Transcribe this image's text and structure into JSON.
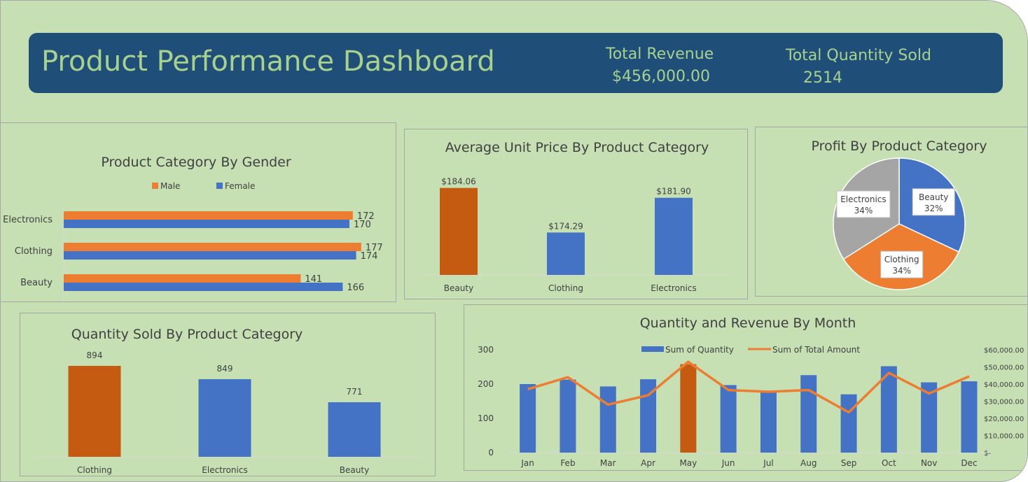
{
  "header": {
    "title": "Product Performance Dashboard",
    "kpis": [
      {
        "label": "Total Revenue",
        "value": "$456,000.00"
      },
      {
        "label": "Total Quantity Sold",
        "value": "2514"
      }
    ]
  },
  "colors": {
    "background": "#c6e0b4",
    "banner": "#1f4e79",
    "banner_text": "#a9d18e",
    "orange": "#ed7d31",
    "dark_orange": "#c55a11",
    "blue": "#4472c4",
    "gray": "#a5a5a5"
  },
  "chart_data": [
    {
      "id": "gender",
      "type": "bar",
      "orientation": "horizontal",
      "title": "Product Category By Gender",
      "categories": [
        "Electronics",
        "Clothing",
        "Beauty"
      ],
      "series": [
        {
          "name": "Male",
          "values": [
            172,
            177,
            141
          ],
          "color": "#ed7d31"
        },
        {
          "name": "Female",
          "values": [
            170,
            174,
            166
          ],
          "color": "#4472c4"
        }
      ],
      "xlim": [
        0,
        200
      ],
      "legend": "top",
      "grid": false
    },
    {
      "id": "price",
      "type": "bar",
      "title": "Average Unit  Price By Product Category",
      "categories": [
        "Beauty",
        "Clothing",
        "Electronics"
      ],
      "values": [
        184.06,
        174.29,
        181.9
      ],
      "value_labels": [
        "$184.06",
        "$174.29",
        "$181.90"
      ],
      "colors": [
        "#c55a11",
        "#4472c4",
        "#4472c4"
      ],
      "ylim": [
        165,
        186
      ],
      "grid": false
    },
    {
      "id": "profit",
      "type": "pie",
      "title": "Profit By Product Category",
      "labels": [
        "Beauty",
        "Clothing",
        "Electronics"
      ],
      "values": [
        32,
        34,
        34
      ],
      "value_labels": [
        "32%",
        "34%",
        "34%"
      ],
      "colors": [
        "#4472c4",
        "#ed7d31",
        "#a5a5a5"
      ]
    },
    {
      "id": "qty",
      "type": "bar",
      "title": "Quantity Sold By Product Category",
      "categories": [
        "Clothing",
        "Electronics",
        "Beauty"
      ],
      "values": [
        894,
        849,
        771
      ],
      "colors": [
        "#c55a11",
        "#4472c4",
        "#4472c4"
      ],
      "ylim": [
        700,
        900
      ],
      "grid": false
    },
    {
      "id": "month",
      "type": "bar",
      "title": "Quantity and Revenue By Month",
      "categories": [
        "Jan",
        "Feb",
        "Mar",
        "Apr",
        "May",
        "Jun",
        "Jul",
        "Aug",
        "Sep",
        "Oct",
        "Nov",
        "Dec"
      ],
      "series": [
        {
          "name": "Sum of Quantity",
          "type": "bar",
          "axis": "left",
          "values": [
            200,
            213,
            193,
            214,
            258,
            197,
            178,
            226,
            170,
            252,
            205,
            208
          ],
          "color": "#4472c4",
          "highlight_index": 4,
          "highlight_color": "#c55a11"
        },
        {
          "name": "Sum of Total Amount",
          "type": "line",
          "axis": "right",
          "values": [
            37000,
            44000,
            28000,
            33500,
            53000,
            36500,
            35500,
            36500,
            23500,
            46500,
            34500,
            44500
          ],
          "color": "#ed7d31"
        }
      ],
      "ylim": [
        0,
        300
      ],
      "yticks": [
        "0",
        "100",
        "200",
        "300"
      ],
      "y2lim": [
        0,
        60000
      ],
      "y2ticks": [
        "$-",
        "$10,000.00",
        "$20,000.00",
        "$30,000.00",
        "$40,000.00",
        "$50,000.00",
        "$60,000.00"
      ],
      "legend": "top",
      "grid": false
    }
  ]
}
